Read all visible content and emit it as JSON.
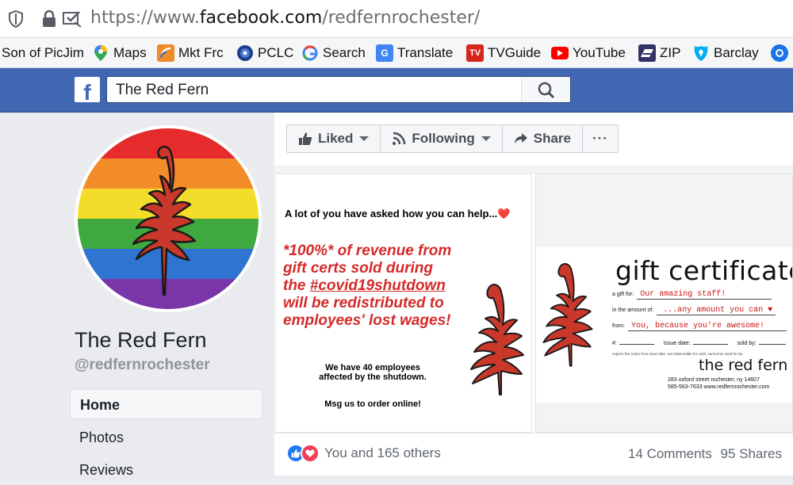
{
  "browser": {
    "url_prefix": "https://www.",
    "url_domain": "facebook.com",
    "url_path": "/redfernrochester/",
    "icons": [
      "shield-icon",
      "lock-icon",
      "tracking-icon"
    ]
  },
  "bookmarks": [
    {
      "label": "Son of PicJim",
      "icon": ""
    },
    {
      "label": "Maps",
      "icon": "maps-pin-icon"
    },
    {
      "label": "Mkt Frc",
      "icon": "rss-icon"
    },
    {
      "label": "PCLC",
      "icon": "globe-icon"
    },
    {
      "label": "Search",
      "icon": "google-icon"
    },
    {
      "label": "Translate",
      "icon": "translate-icon"
    },
    {
      "label": "TVGuide",
      "icon": "tvguide-icon"
    },
    {
      "label": "YouTube",
      "icon": "youtube-icon"
    },
    {
      "label": "ZIP",
      "icon": "usps-icon"
    },
    {
      "label": "Barclay",
      "icon": "barclay-icon"
    }
  ],
  "facebook": {
    "logo": "f",
    "search_value": "The Red Fern"
  },
  "page": {
    "name": "The Red Fern",
    "handle": "@redfernrochester",
    "nav": [
      "Home",
      "Photos",
      "Reviews"
    ]
  },
  "actions": {
    "liked": "Liked",
    "following": "Following",
    "share": "Share",
    "more": "···"
  },
  "post_left": {
    "intro": "A lot of you have asked how you can help...❤️",
    "line1": "*100%* of revenue from",
    "line2": "gift certs sold during",
    "line3_pre": "the ",
    "line3_tag": "#covid19shutdown",
    "line4": "will be redistributed to",
    "line5": "employees' lost wages!",
    "employees_1": "We have 40 employees",
    "employees_2": "affected by the shutdown.",
    "order": "Msg us to order online!"
  },
  "post_right": {
    "title": "gift certificate",
    "for_label": "a gift for:",
    "for_value": "Our amazing staff!",
    "amount_label": "in the amount of:",
    "amount_value": "...any amount you can ♥",
    "from_label": "from:",
    "from_value": "You, because you're awesome!",
    "number_label": "#:",
    "issue_label": "issue date:",
    "sold_label": "sold by:",
    "fine_print": "expires five years from issue date. not redeemable for cash, cannot be used for tip.",
    "brand": "the red fern",
    "addr1": "283 oxford street     rochester, ny 14607",
    "addr2": "585-563-7633     www.redfernrochester.com"
  },
  "engagement": {
    "reactions_text": "You and 165 others",
    "comments": "14 Comments",
    "shares": "95 Shares"
  },
  "colors": {
    "fb_blue": "#4267b2",
    "fern_red": "#c9382a",
    "text_red": "#d42a2a"
  }
}
